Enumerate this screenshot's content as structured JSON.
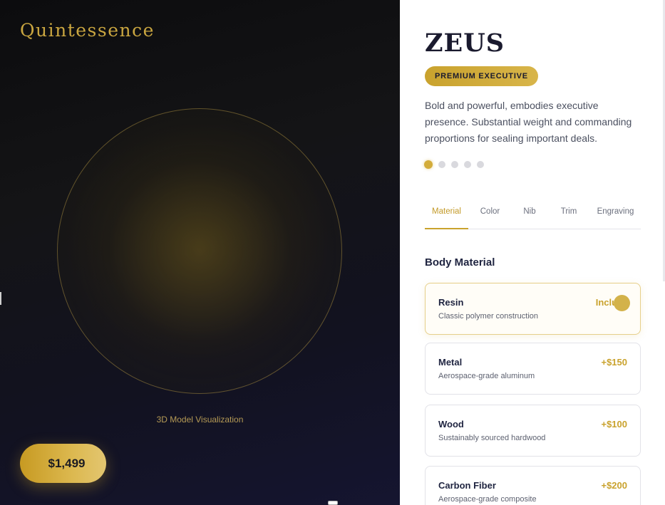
{
  "brand": "Quintessence",
  "stage": {
    "visualization_label": "3D Model Visualization",
    "price": "$1,499"
  },
  "product": {
    "name": "ZEUS",
    "tier": "PREMIUM EXECUTIVE",
    "description": "Bold and powerful, embodies executive presence. Substantial weight and commanding proportions for sealing important deals.",
    "carousel": {
      "count": 5,
      "active_index": 0
    }
  },
  "tabs": [
    {
      "label": "Material",
      "active": true
    },
    {
      "label": "Color",
      "active": false
    },
    {
      "label": "Nib",
      "active": false
    },
    {
      "label": "Trim",
      "active": false
    },
    {
      "label": "Engraving",
      "active": false
    }
  ],
  "section": {
    "title": "Body Material"
  },
  "options": [
    {
      "name": "Resin",
      "subtitle": "Classic polymer construction",
      "price": "Includ",
      "selected": true
    },
    {
      "name": "Metal",
      "subtitle": "Aerospace-grade aluminum",
      "price": "+$150",
      "selected": false
    },
    {
      "name": "Wood",
      "subtitle": "Sustainably sourced hardwood",
      "price": "+$100",
      "selected": false
    },
    {
      "name": "Carbon Fiber",
      "subtitle": "Aerospace-grade composite",
      "price": "+$200",
      "selected": false
    }
  ],
  "colors": {
    "accent": "#c9a22d",
    "stage_bg": "#121220",
    "heading": "#1f2440"
  }
}
